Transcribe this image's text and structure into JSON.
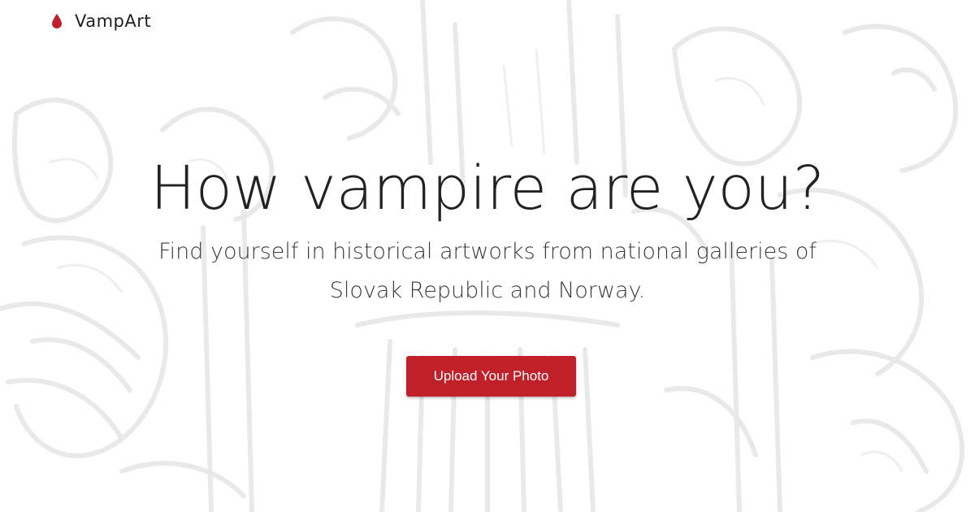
{
  "header": {
    "logo_text": "VampArt",
    "logo_icon": "blood-drop-icon",
    "brand_color": "#c0202a"
  },
  "hero": {
    "title": "How vampire are you?",
    "subtitle": "Find yourself in historical artworks from national galleries of Slovak Republic and Norway."
  },
  "cta": {
    "label": "Upload Your Photo",
    "color": "#c0202a"
  },
  "background": {
    "style": "faded woodcut illustration",
    "line_color": "#ececec"
  }
}
